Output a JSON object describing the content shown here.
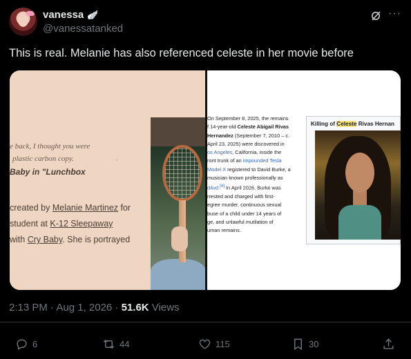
{
  "post": {
    "author_name": "vanessa",
    "author_emoji": "🪽",
    "author_handle": "@vanessatanked",
    "text": "This is real. Melanie has also referenced celeste in her movie before",
    "timestamp": "2:13 PM · Aug 1, 2026 · ",
    "views_count": "51.6K",
    "views_label": " Views"
  },
  "media": {
    "left": {
      "quote_line_1": "e back, I thought you were",
      "quote_line_2": "plastic carbon copy.",
      "quote_line_3": "Baby in \"Lunchbox",
      "wiki_line_1_pre": "created by ",
      "wiki_line_1_link": "Melanie Martinez",
      "wiki_line_1_post": " for",
      "wiki_line_2_pre": "student at ",
      "wiki_line_2_link": "K-12 Sleepaway",
      "wiki_line_3_pre": "with ",
      "wiki_line_3_link": "Cry Baby",
      "wiki_line_3_post": ". She is portrayed"
    },
    "right": {
      "lines": [
        {
          "a": "On September 8, 2025, the remains"
        },
        {
          "a": "f 14-year-old ",
          "b": "Celeste Abigail Rivas"
        },
        {
          "b": "Hernandez",
          "a2": " (September 7, 2010 – c."
        },
        {
          "a": "April 23, 2025) were discovered in"
        },
        {
          "link": "os Angeles",
          "a2": ", California, inside the"
        },
        {
          "a": "ront trunk of an ",
          "link": "impounded Tesla"
        },
        {
          "link": "Model X",
          "a2": " registered to David Burke, a"
        },
        {
          "a": "musician known professionally as"
        },
        {
          "link": "d4vd.",
          "sup": "[4]",
          "a2": " In April 2026, Burke was"
        },
        {
          "a": "rrested and charged with first-"
        },
        {
          "a": "egree murder, continuous sexual"
        },
        {
          "a": "buse of a child under 14 years of"
        },
        {
          "a": "ge, and unlawful mutilation of"
        },
        {
          "a": "uman remains."
        }
      ],
      "infobox_title_pre": "Killing of ",
      "infobox_title_highlight": "Celeste",
      "infobox_title_post": " Rivas Hernan"
    }
  },
  "actions": {
    "replies": "6",
    "reposts": "44",
    "likes": "115",
    "bookmarks": "30"
  },
  "icons": {
    "grok": "grok-icon",
    "more": "more-icon",
    "reply": "reply-icon",
    "repost": "repost-icon",
    "like": "heart-icon",
    "bookmark": "bookmark-icon",
    "share": "share-icon"
  },
  "colors": {
    "background": "#000000",
    "text_primary": "#e7e9ea",
    "text_secondary": "#71767b",
    "wiki_link": "#3366cc"
  }
}
